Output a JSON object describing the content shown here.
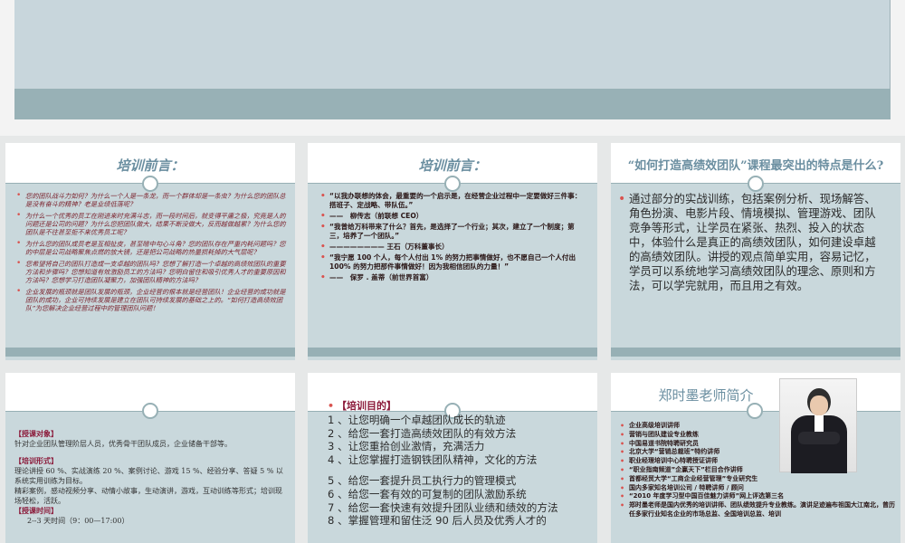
{
  "slide2": {
    "title": "培训前言：",
    "items": [
      "您的团队战斗力如何？为什么一个人是一条龙，而一个群体却是一条虫？为什么您的团队总是没有奋斗的精神？老是业绩低落呢？",
      "为什么一个优秀的员工在刚进来时充满斗志，而一段时间后，就变得平庸之极，究竟是人的问题还是公司的问题？为什么您把团队做大，结果不断没做大，反而越做越累？为什么您的团队是不往甚至拒不来优秀员工呢？",
      "为什么您的团队成员老是互相扯皮，甚至暗中勾心斗角？您的团队存在严重内耗问题吗？您的中层是公司战略聚焦点燃的放大镜，还是把公司战略的热量损耗掉的大气层呢？",
      "您希望将自己的团队打造成一支卓越的团队吗？您想了解打造一个卓越的高绩效团队的重要方法和步骤吗？您想知道有效激励员工的方法吗？您明白留住和吸引优秀人才的重要原因和方法吗？您想学习打造团队凝聚力，加强团队精神的方法吗？",
      "企业发展的瓶颈就是团队发展的瓶颈，企业经营的根本就是经营团队！企业经营的成功就是团队的成功，企业可持续发展是建立在团队可持续发展的基础之上的。“如何打造高绩效团队”为您解决企业经营过程中的管理团队问题！"
    ]
  },
  "slide3": {
    "title": "培训前言：",
    "items": [
      "“以我办联想的体会，最重要的一个启示是，在经营企业过程中一定要做好三件事：搭班子、定战略、带队伍。”",
      "——　柳传志（前联想 CEO）",
      "“我曾给万科带来了什么？首先，是选择了一个行业；其次，建立了一个制度；第三，培养了一个团队。”",
      "———————— 王石（万科董事长）",
      "“我宁愿 100 个人，每个人付出 1% 的努力把事情做好，也不愿自己一个人付出 100% 的努力把那件事情做好！因为我相信团队的力量！”",
      "——　保罗 . 盖蒂（前世界首富）"
    ]
  },
  "slide4": {
    "title": "“如何打造高绩效团队”课程最突出的特点是什么?",
    "body": "通过部分的实战训练，包括案例分析、现场解答、角色扮演、电影片段、情境模拟、管理游戏、团队竞争等形式，让学员在紧张、热烈、投入的状态中，体验什么是真正的高绩效团队，如何建设卓越的高绩效团队。讲授的观点简单实用，容易记忆，学员可以系统地学习高绩效团队的理念、原则和方法，可以学完就用，而且用之有效。"
  },
  "slide5": {
    "object_label": "【授课对象】",
    "object_text": "针对企业团队管理阶层人员，优秀骨干团队成员，企业储备干部等。",
    "form_label": "【培训形式】",
    "form_text": "理论讲授 60 %、实战演练 20 %、案例讨论、游戏 15 %、经验分享、答疑 5 % 以系统实用训练为目标。",
    "form_text2": "精彩案例，感动视频分享、动情小故事，生动演讲，游戏，互动训练等形式；培训现场轻松，活跃。",
    "time_label": "【授课时间】",
    "time_text": "2--3 天时间（9：00—17:00）"
  },
  "slide6": {
    "label": "【培训目的】",
    "goals": [
      "1 、让您明确一个卓越团队成长的轨迹",
      "2 、给您一套打造高绩效团队的有效方法",
      "3 、让您重拾创业激情，充满活力",
      "4 、让您掌握打造钢铁团队精神，文化的方法",
      "5 、给您一套提升员工执行力的管理模式",
      "6 、给您一套有效的可复制的团队激励系统",
      "7 、给您一套快速有效提升团队业绩和绩效的方法",
      "8 、掌握管理和留住泛 90 后人员及优秀人才的"
    ]
  },
  "slide7": {
    "title": "郑时墨老师简介",
    "items": [
      "企业高级培训讲师",
      "营销与团队建设专业教练",
      "中国易道书院特聘研究员",
      "北京大学“营销总裁班”特约讲师",
      "职业经理培训中心特聘授证讲师",
      "“职业指南频道”企赢天下”栏目合作讲师",
      "首都经贸大学“工商企业经营管理”专业研究生",
      "国内多家知名培训公司 / 特聘讲师 / 顾问",
      "“2010 年度学习型中国百佳魅力讲师”网上评选第三名",
      "郑时墨老师是国内优秀的培训讲师、团队绩效提升专业教练。演讲足迹遍布祖国大江南北，曾历任多家行业知名企业的市场总监、全国培训总监、培训"
    ]
  },
  "colors": {
    "band": "#97b0b5",
    "slide_bg": "#c9d8dc",
    "title": "#6a8ea0",
    "bullet": "#d9534f",
    "label": "#8b1a3a"
  }
}
